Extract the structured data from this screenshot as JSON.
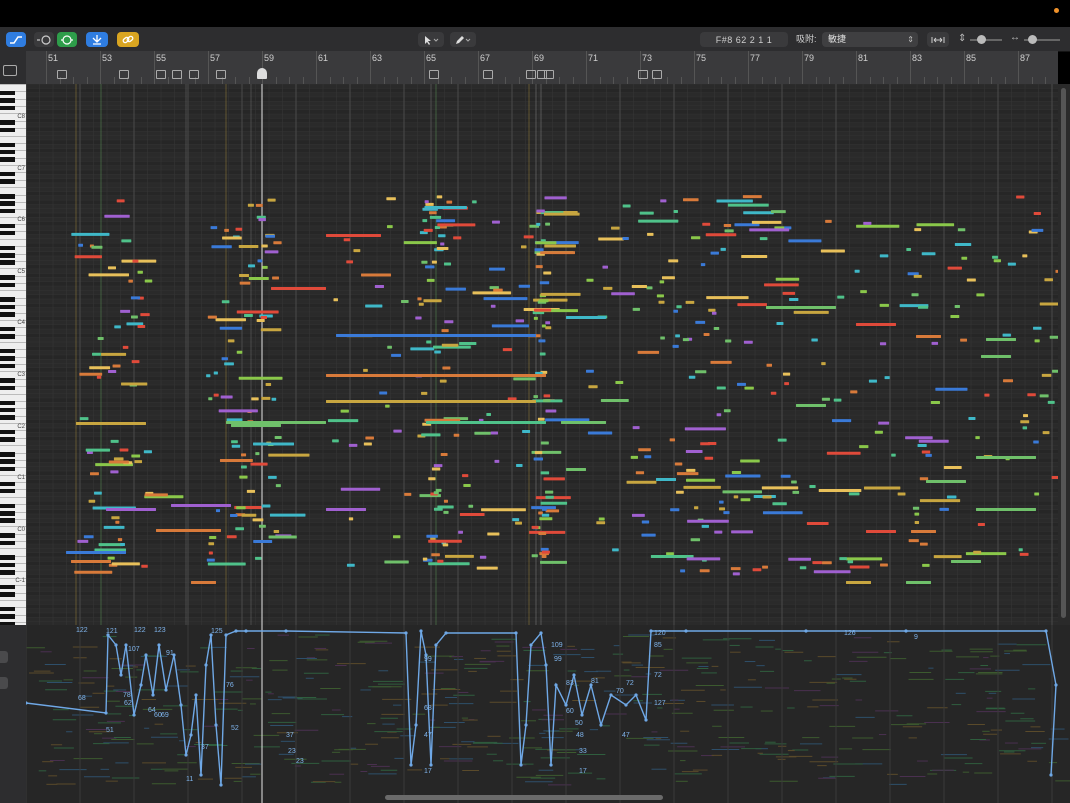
{
  "toolbar": {
    "lcd_text": "F#8   62 2 1 1",
    "snap_label": "吸附:",
    "snap_value": "敏捷"
  },
  "ruler": {
    "bars": [
      "51",
      "53",
      "55",
      "57",
      "59",
      "61",
      "63",
      "65",
      "67",
      "69",
      "71",
      "73",
      "75",
      "77",
      "79",
      "81",
      "83",
      "85",
      "87"
    ]
  },
  "keyboard": {
    "octave_labels": [
      "C8",
      "C7",
      "C6",
      "C5",
      "C4",
      "C3",
      "C2",
      "C1",
      "C0",
      "C-1"
    ]
  },
  "automation": {
    "value_labels": [
      "122",
      "121",
      "122",
      "123",
      "125",
      "107",
      "91",
      "78",
      "62",
      "64",
      "69",
      "60",
      "68",
      "51",
      "37",
      "23",
      "11",
      "76",
      "52",
      "37",
      "23",
      "99",
      "68",
      "47",
      "17",
      "109",
      "99",
      "83",
      "81",
      "60",
      "50",
      "48",
      "70",
      "72",
      "47",
      "33",
      "17",
      "120",
      "85",
      "72",
      "127",
      "126",
      "9"
    ]
  },
  "colors": {
    "accent_blue": "#2f7de1",
    "green_btn": "#2e9d4a",
    "yellow_btn": "#d9a521",
    "automation_line": "#6fa8e6"
  },
  "icons": [
    "automation-curve-icon",
    "midi-in-icon",
    "smart-quantize-icon",
    "catch-icon",
    "link-icon",
    "pointer-tool-icon",
    "pencil-tool-icon",
    "fit-icon",
    "vertical-zoom-icon",
    "horizontal-zoom-icon"
  ]
}
